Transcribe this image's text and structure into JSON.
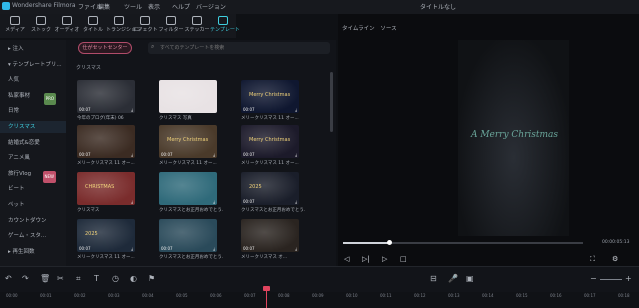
{
  "app": {
    "name": "Wondershare Filmora",
    "project_title": "タイトルなし"
  },
  "menu": [
    "ファイル",
    "編集",
    "ツール",
    "表示",
    "ヘルプ",
    "バージョン"
  ],
  "toolbar": [
    {
      "label": "メディア",
      "icon": "media-icon"
    },
    {
      "label": "ストック",
      "icon": "stock-icon"
    },
    {
      "label": "オーディオ",
      "icon": "audio-icon"
    },
    {
      "label": "タイトル",
      "icon": "title-icon"
    },
    {
      "label": "トランジション",
      "icon": "transition-icon"
    },
    {
      "label": "エフェクト",
      "icon": "effect-icon"
    },
    {
      "label": "フィルター",
      "icon": "filter-icon"
    },
    {
      "label": "ステッカー",
      "icon": "sticker-icon"
    },
    {
      "label": "テンプレート",
      "icon": "template-icon"
    }
  ],
  "sidebar": [
    {
      "label": "▸ 注入"
    },
    {
      "label": "▾ テンプレートプリ..."
    },
    {
      "label": "人気"
    },
    {
      "label": "私家事材",
      "badge": "PRO",
      "badge_color": "#5a8a4e"
    },
    {
      "label": "日常"
    },
    {
      "label": "クリスマス",
      "active": true
    },
    {
      "label": "結婚式&恋愛"
    },
    {
      "label": "アニメ風"
    },
    {
      "label": "旅行Vlog",
      "badge": "NEW",
      "badge_color": "#c0506a"
    },
    {
      "label": "ビート"
    },
    {
      "label": "ペット"
    },
    {
      "label": "カウントダウン"
    },
    {
      "label": "ゲーム・スタ..."
    },
    {
      "label": "▸ 再生回数"
    }
  ],
  "asset_center": "仕がセットセンター",
  "search_placeholder": "すべてのテンプレートを検索",
  "section_title": "クリスマス",
  "cards": [
    {
      "label": "今年のプログ(年末) 06",
      "thumb": "#2b2e36",
      "time": "00:07"
    },
    {
      "label": "クリスマス 写真",
      "thumb": "#e8e2e4",
      "time": ""
    },
    {
      "label": "メリークリスマス 11 オー...",
      "thumb": "#0f1730",
      "time": "00:07",
      "caption": "Merry Christmas"
    },
    {
      "label": "メリークリスマス 11 オー...",
      "thumb": "#3b2b22",
      "time": "00:07"
    },
    {
      "label": "メリークリスマス 11 オー...",
      "thumb": "#4a3a2a",
      "time": "00:07",
      "caption": "Merry Christmas"
    },
    {
      "label": "メリークリスマス 11 オー...",
      "thumb": "#1c1a2a",
      "time": "00:07",
      "caption": "Merry Christmas"
    },
    {
      "label": "クリスマス",
      "thumb": "#7a2c2c",
      "time": "",
      "caption": "CHRISTMAS"
    },
    {
      "label": "クリスマスとお正月おめでとう...",
      "thumb": "#2f6a7a",
      "time": ""
    },
    {
      "label": "クリスマスとお正月おめでとう...",
      "thumb": "#1a1e2a",
      "time": "00:07",
      "caption": "2025"
    },
    {
      "label": "メリークリスマス 11 オー...",
      "thumb": "#1e2a3a",
      "time": "00:07",
      "caption": "2025"
    },
    {
      "label": "クリスマスとお正月おめでとう...",
      "thumb": "#2a4a5a",
      "time": "00:07"
    },
    {
      "label": "メリークリスマス オ...",
      "thumb": "#2a2420",
      "time": "00:07"
    }
  ],
  "preview": {
    "tabs": [
      "タイムライン",
      "ソース"
    ],
    "overlay_text": "A Merry Christmas",
    "time": "00:00:05:13",
    "progress": 0.19
  },
  "ruler_ticks": [
    "00:00",
    "00:01",
    "00:02",
    "00:03",
    "00:04",
    "00:05",
    "00:06",
    "00:07",
    "00:08",
    "00:09",
    "00:10",
    "00:11",
    "00:12",
    "00:13",
    "00:14",
    "00:15",
    "00:16",
    "00:17",
    "00:18"
  ]
}
